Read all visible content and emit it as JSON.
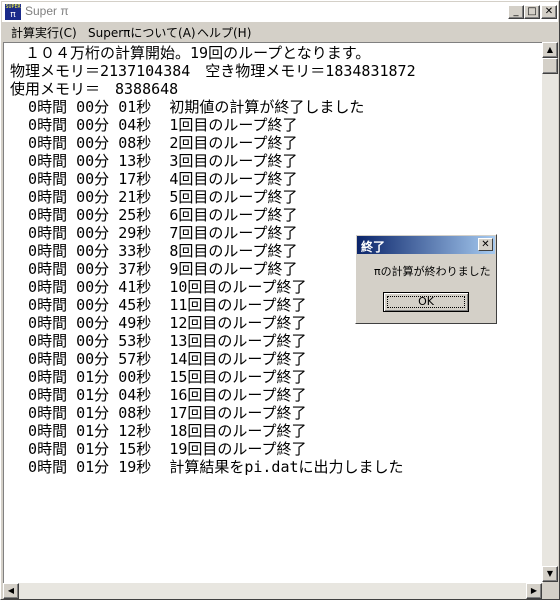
{
  "window": {
    "title": "Super π",
    "icon_text": "SUPER",
    "icon_symbol": "π",
    "minimize_glyph": "_",
    "maximize_glyph": "□",
    "close_glyph": "✕"
  },
  "menu": [
    {
      "label": "計算実行(C)"
    },
    {
      "label": "Superπについて(A)"
    },
    {
      "label": "ヘルプ(H)"
    }
  ],
  "log_lines": [
    "　１０４万桁の計算開始。19回のループとなります。",
    "物理メモリ＝2137104384　空き物理メモリ＝1834831872",
    "使用メモリ＝　8388648",
    "  0時間 00分 01秒  初期値の計算が終了しました",
    "  0時間 00分 04秒  1回目のループ終了",
    "  0時間 00分 08秒  2回目のループ終了",
    "  0時間 00分 13秒  3回目のループ終了",
    "  0時間 00分 17秒  4回目のループ終了",
    "  0時間 00分 21秒  5回目のループ終了",
    "  0時間 00分 25秒  6回目のループ終了",
    "  0時間 00分 29秒  7回目のループ終了",
    "  0時間 00分 33秒  8回目のループ終了",
    "  0時間 00分 37秒  9回目のループ終了",
    "  0時間 00分 41秒  10回目のループ終了",
    "  0時間 00分 45秒  11回目のループ終了",
    "  0時間 00分 49秒  12回目のループ終了",
    "  0時間 00分 53秒  13回目のループ終了",
    "  0時間 00分 57秒  14回目のループ終了",
    "  0時間 01分 00秒  15回目のループ終了",
    "  0時間 01分 04秒  16回目のループ終了",
    "  0時間 01分 08秒  17回目のループ終了",
    "  0時間 01分 12秒  18回目のループ終了",
    "  0時間 01分 15秒  19回目のループ終了",
    "  0時間 01分 19秒  計算結果をpi.datに出力しました"
  ],
  "dialog": {
    "title": "終了",
    "message": "πの計算が終わりました",
    "ok_label": "OK",
    "close_glyph": "✕"
  },
  "scrollbar": {
    "up_glyph": "▲",
    "down_glyph": "▼",
    "left_glyph": "◀",
    "right_glyph": "▶"
  }
}
